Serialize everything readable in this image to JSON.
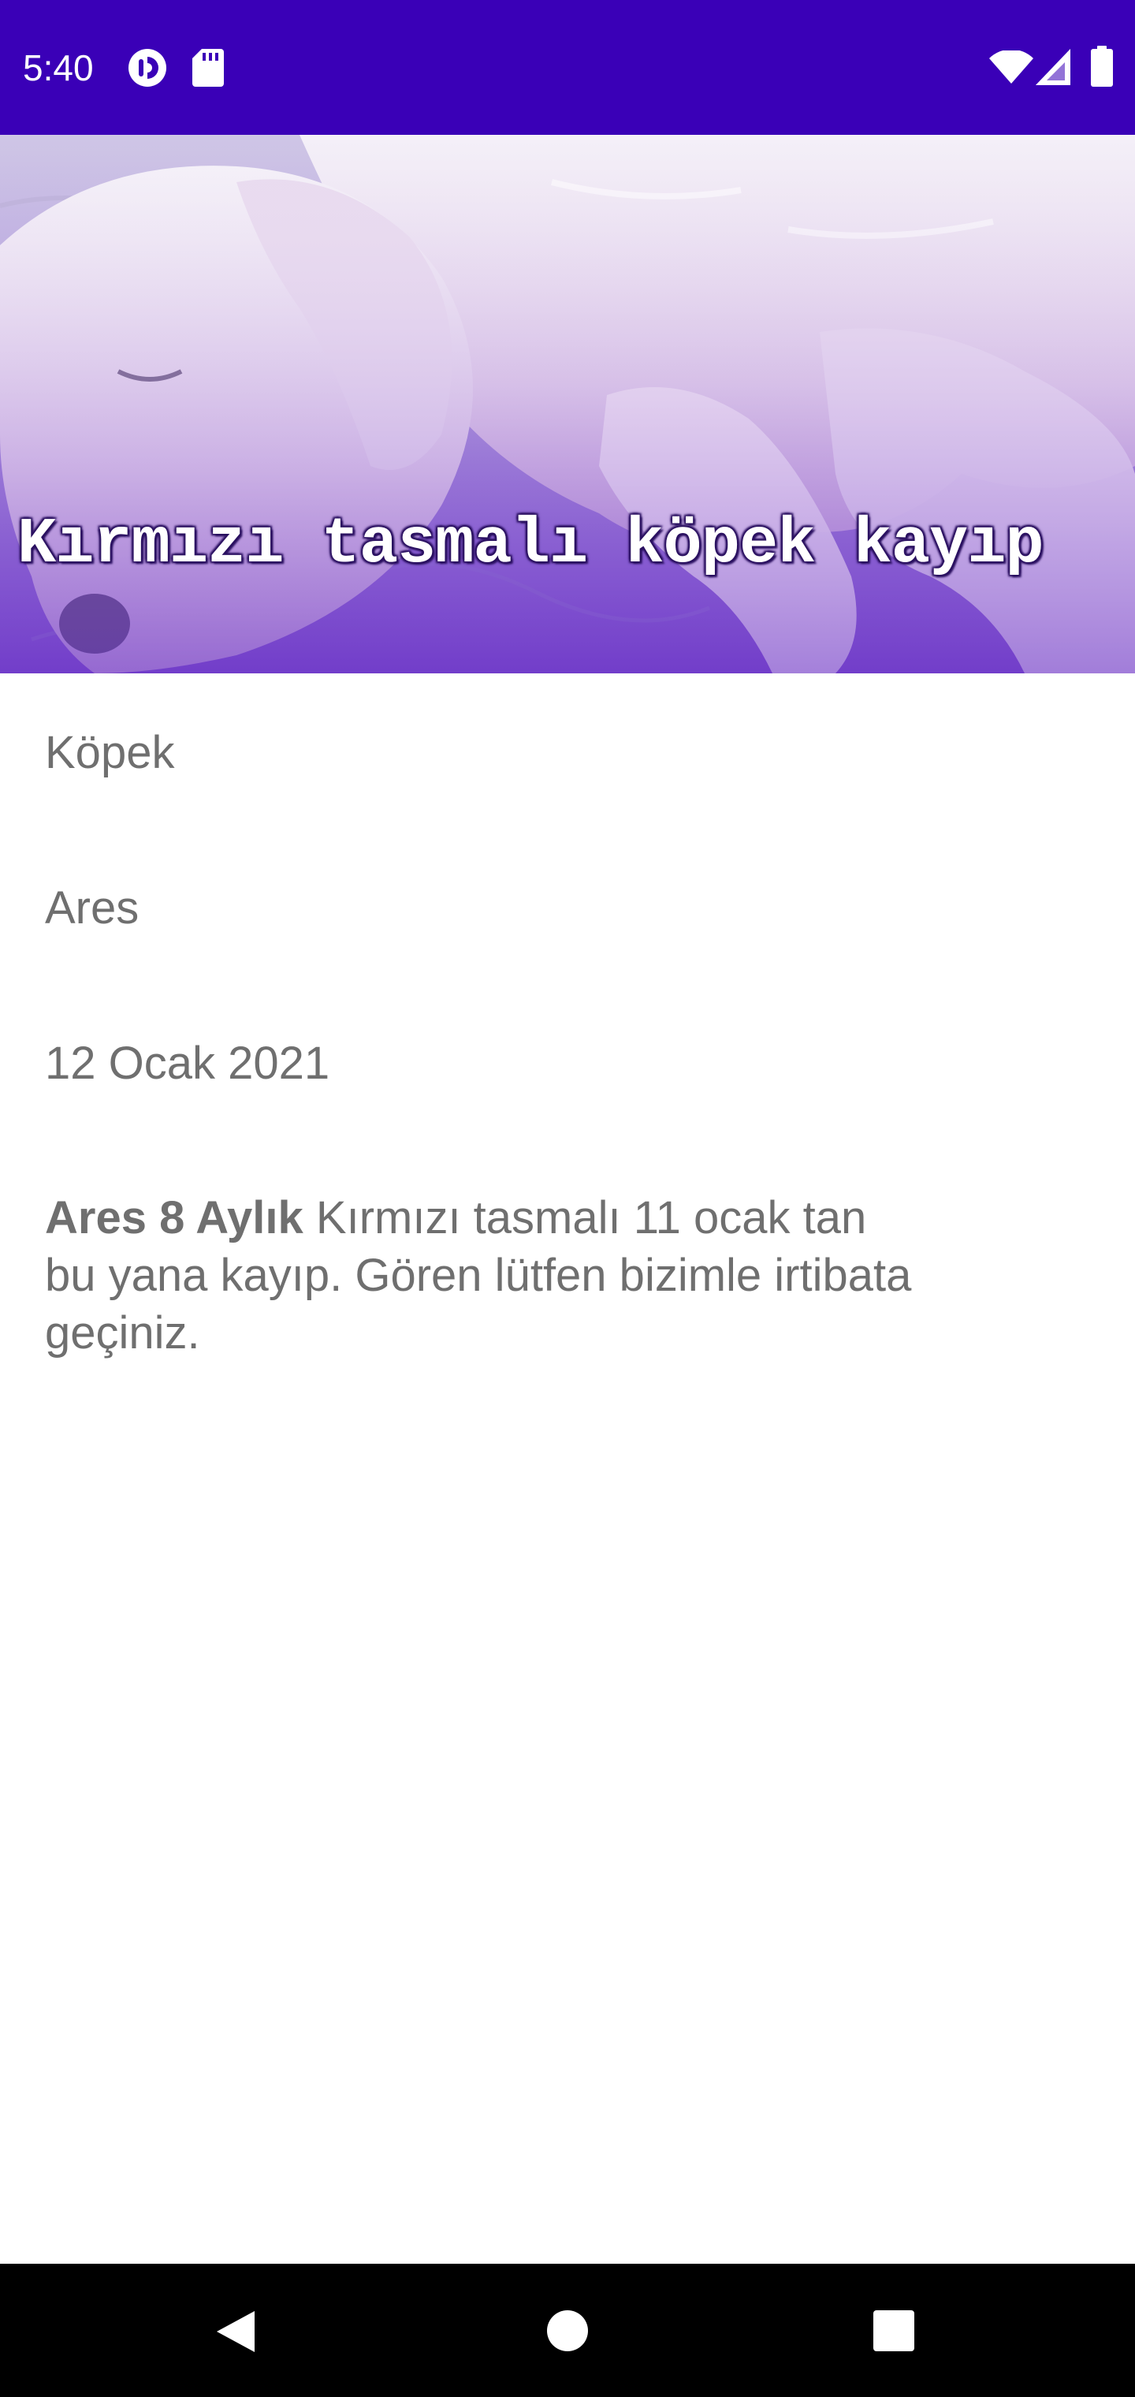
{
  "status_bar": {
    "time": "5:40",
    "icons_left": [
      "pocket-casts-icon",
      "sd-card-icon"
    ],
    "icons_right": [
      "wifi-icon",
      "cell-signal-icon",
      "battery-icon"
    ],
    "background": "#3a00b7"
  },
  "hero": {
    "caption": "Kırmızı tasmalı köpek kayıp",
    "image": "sleeping-puppy-photo"
  },
  "details": {
    "type": "Köpek",
    "name": "Ares",
    "date": "12 Ocak 2021",
    "description_bold": "Ares 8 Aylık",
    "description_line1_rest": " Kırmızı tasmalı 11 ocak tan",
    "description_line2": "bu yana kayıp. Gören lütfen bizimle irtibata",
    "description_line3": "geçiniz."
  },
  "nav_bar": {
    "buttons": [
      "back-icon",
      "home-icon",
      "recents-icon"
    ]
  }
}
